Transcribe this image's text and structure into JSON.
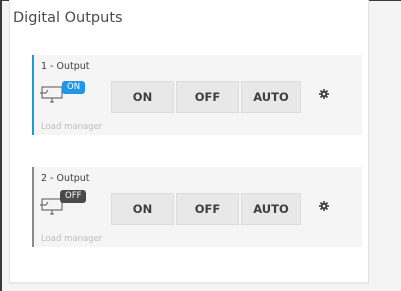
{
  "panel": {
    "title": "Digital Outputs"
  },
  "outputs": [
    {
      "title": "1 - Output",
      "state_badge": "ON",
      "state_color": "#2196e6",
      "accent_color": "#1e9bd7",
      "icon": "output-device-icon",
      "buttons": {
        "on": "ON",
        "off": "OFF",
        "auto": "AUTO"
      },
      "settings_icon": "gear-icon",
      "footer": "Load manager"
    },
    {
      "title": "2 - Output",
      "state_badge": "OFF",
      "state_color": "#4a4a4a",
      "accent_color": "#8a8a8a",
      "icon": "output-device-icon",
      "buttons": {
        "on": "ON",
        "off": "OFF",
        "auto": "AUTO"
      },
      "settings_icon": "gear-icon",
      "footer": "Load manager"
    }
  ]
}
